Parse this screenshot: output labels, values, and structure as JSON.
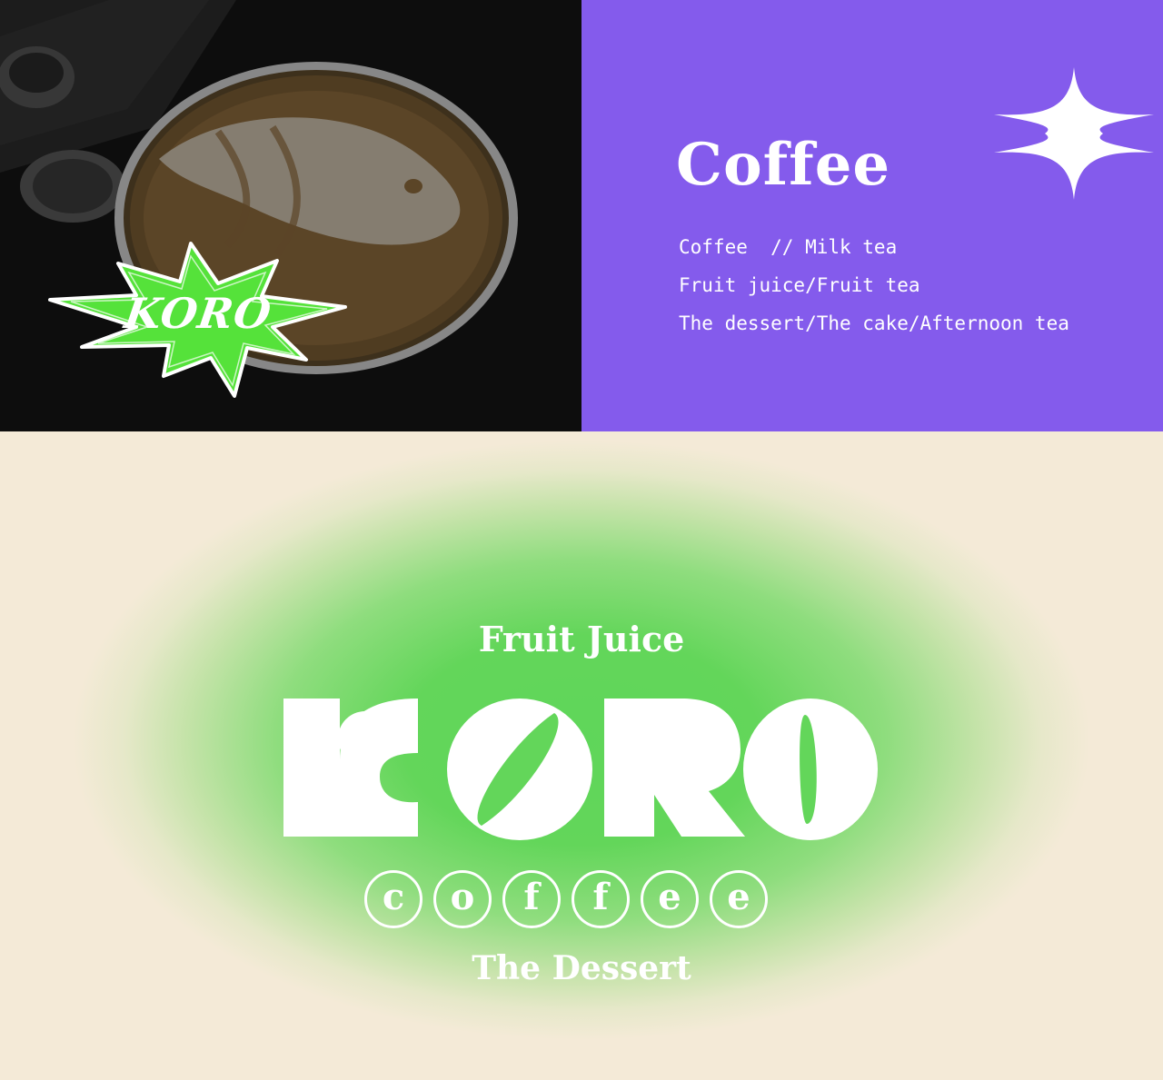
{
  "photo_panel": {
    "badge_text": "KORO",
    "badge_color": "#55e23a"
  },
  "purple_panel": {
    "background": "#845bec",
    "title": "Coffee",
    "menu_lines": [
      "Coffee  // Milk tea",
      "Fruit juice/Fruit tea",
      "The dessert/The cake/Afternoon tea"
    ]
  },
  "bottom_panel": {
    "top_line": "Fruit Juice",
    "brand": "KORO",
    "circled_letters": [
      "c",
      "o",
      "f",
      "f",
      "e",
      "e"
    ],
    "bottom_line": "The Dessert",
    "accent_green": "#5fd65a",
    "background": "#f4ead7"
  }
}
